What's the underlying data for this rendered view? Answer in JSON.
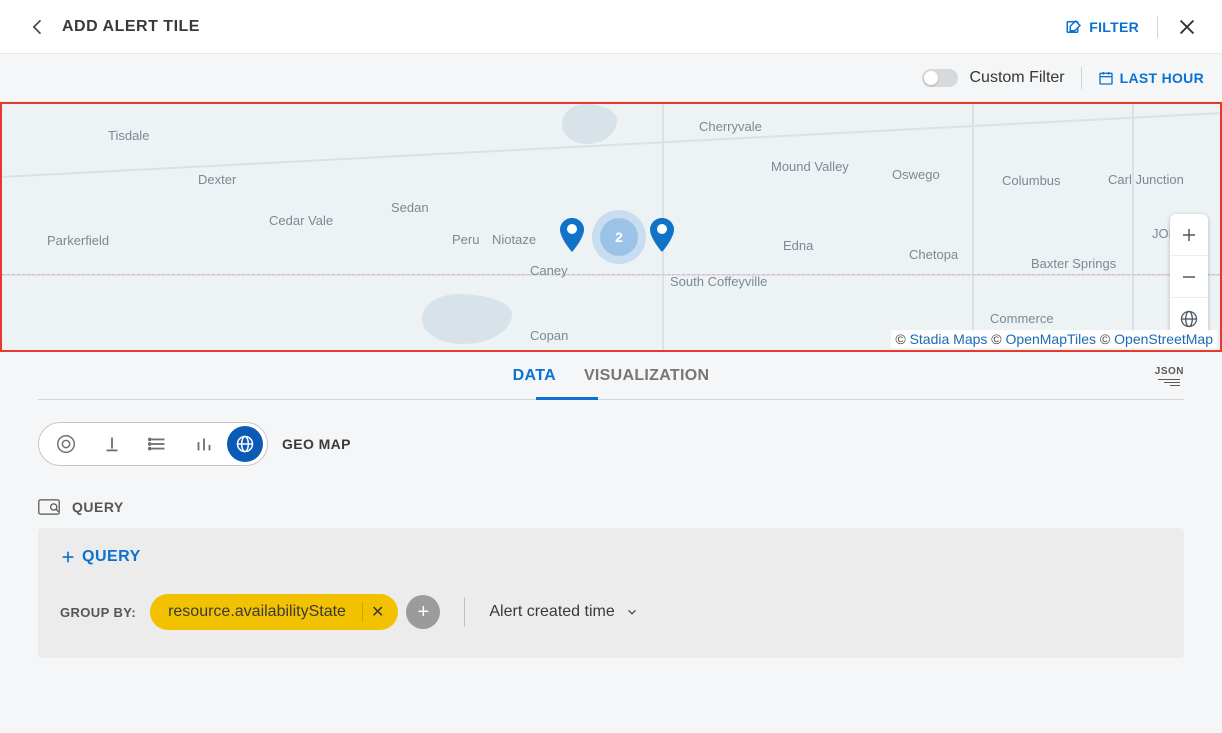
{
  "header": {
    "title": "ADD ALERT TILE",
    "filter_label": "FILTER"
  },
  "subheader": {
    "custom_filter_label": "Custom Filter",
    "lasthour_label": "LAST HOUR"
  },
  "map": {
    "cluster_count": "2",
    "cities": {
      "tisdale": "Tisdale",
      "dexter": "Dexter",
      "cedar_vale": "Cedar Vale",
      "sedan": "Sedan",
      "peru": "Peru",
      "niotaze": "Niotaze",
      "caney": "Caney",
      "copan": "Copan",
      "cherryvale": "Cherryvale",
      "mound_valley": "Mound Valley",
      "south_coffeyville": "South Coffeyville",
      "edna": "Edna",
      "oswego": "Oswego",
      "chetopa": "Chetopa",
      "columbus": "Columbus",
      "baxter_springs": "Baxter Springs",
      "commerce": "Commerce",
      "carl_junction": "Carl Junction",
      "parkerfield": "Parkerfield",
      "jop": "JOF"
    },
    "attrib": {
      "copy1": "© ",
      "stadia": "Stadia Maps",
      "copy2": " © ",
      "openmaptiles": "OpenMapTiles",
      "copy3": " © ",
      "osm": "OpenStreetMap"
    }
  },
  "tabs": {
    "data": "DATA",
    "visualization": "VISUALIZATION",
    "json": "JSON"
  },
  "viz": {
    "selected_label": "GEO MAP"
  },
  "query": {
    "section_label": "QUERY",
    "add_label": "QUERY",
    "groupby_label": "GROUP BY:",
    "groupby_chip": "resource.availabilityState",
    "sort_label": "Alert created time"
  }
}
